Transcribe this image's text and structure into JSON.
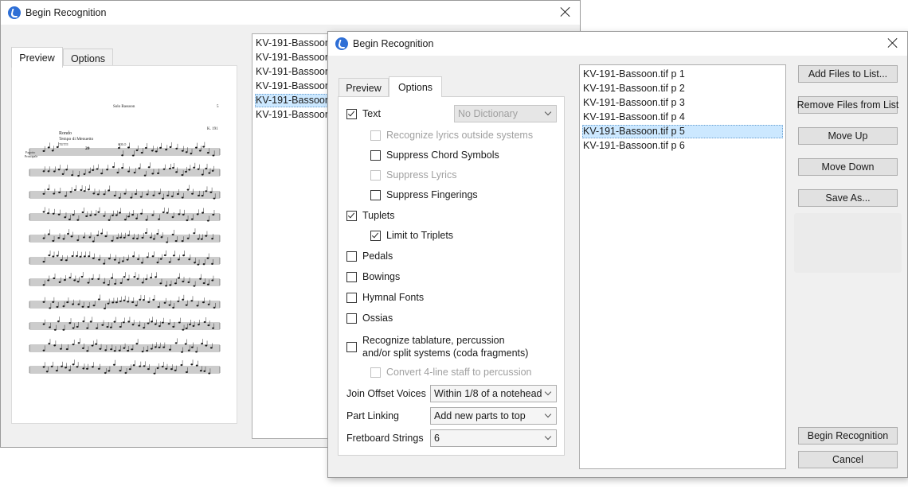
{
  "back_window": {
    "title": "Begin Recognition",
    "tabs": [
      {
        "label": "Preview"
      },
      {
        "label": "Options"
      }
    ],
    "files": [
      "KV-191-Bassoon.t",
      "KV-191-Bassoon.t",
      "KV-191-Bassoon.t",
      "KV-191-Bassoon.t",
      "KV-191-Bassoon.t",
      "KV-191-Bassoon.t"
    ],
    "score": {
      "header": "Solo Bassoon",
      "page_no": "5",
      "catalog": "K. 191",
      "movement": "Rondo",
      "tempo": "Tempo di Menuetto",
      "instrument_line1": "Fagotto",
      "instrument_line2": "Principale",
      "annot_tutti": "TUTTI",
      "annot_solo": "SOLO",
      "rest_count": "20",
      "measure_8": "8"
    }
  },
  "front_window": {
    "title": "Begin Recognition",
    "tabs": [
      {
        "label": "Preview"
      },
      {
        "label": "Options"
      }
    ],
    "options": {
      "text": {
        "label": "Text",
        "checked": true
      },
      "dictionary": {
        "value": "No Dictionary"
      },
      "recognize_lyrics": {
        "label": "Recognize lyrics outside systems"
      },
      "suppress_chords": {
        "label": "Suppress Chord Symbols"
      },
      "suppress_lyrics": {
        "label": "Suppress Lyrics"
      },
      "suppress_fingerings": {
        "label": "Suppress Fingerings"
      },
      "tuplets": {
        "label": "Tuplets",
        "checked": true
      },
      "limit_triplets": {
        "label": "Limit to Triplets",
        "checked": true
      },
      "pedals": {
        "label": "Pedals"
      },
      "bowings": {
        "label": "Bowings"
      },
      "hymnal": {
        "label": "Hymnal Fonts"
      },
      "ossias": {
        "label": "Ossias"
      },
      "tablature": {
        "label_line1": "Recognize tablature, percussion",
        "label_line2": "and/or split systems (coda fragments)"
      },
      "convert_staff": {
        "label": "Convert 4-line staff to percussion"
      },
      "join_offset": {
        "label": "Join Offset Voices",
        "value": "Within 1/8 of a notehead"
      },
      "part_linking": {
        "label": "Part Linking",
        "value": "Add new parts to top"
      },
      "fretboard": {
        "label": "Fretboard Strings",
        "value": "6"
      }
    },
    "files": [
      "KV-191-Bassoon.tif p  1",
      "KV-191-Bassoon.tif p  2",
      "KV-191-Bassoon.tif p  3",
      "KV-191-Bassoon.tif p  4",
      "KV-191-Bassoon.tif p  5",
      "KV-191-Bassoon.tif p  6"
    ],
    "selected_index": 4,
    "buttons": {
      "add_files": "Add Files to List...",
      "remove_files": "Remove Files from List",
      "move_up": "Move Up",
      "move_down": "Move Down",
      "save_as": "Save As...",
      "begin": "Begin Recognition",
      "cancel": "Cancel"
    }
  }
}
